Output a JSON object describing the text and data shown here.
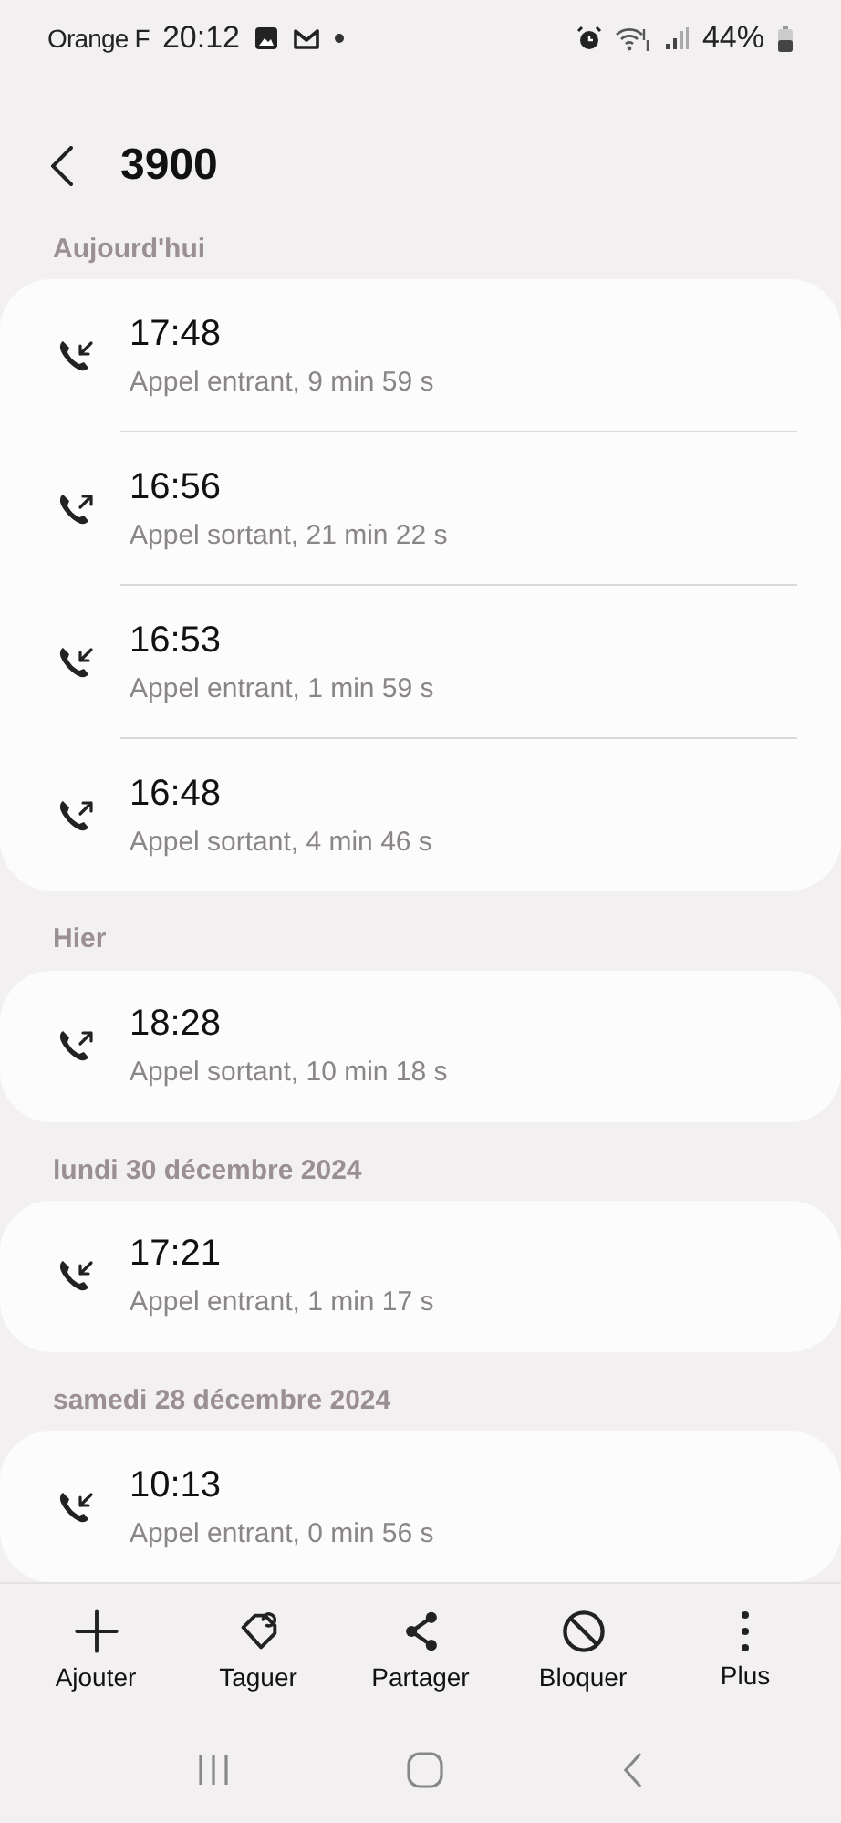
{
  "status_bar": {
    "carrier": "Orange F",
    "time": "20:12",
    "battery": "44%"
  },
  "header": {
    "title": "3900"
  },
  "sections": [
    {
      "label": "Aujourd'hui",
      "calls": [
        {
          "kind": "incoming",
          "time": "17:48",
          "detail": "Appel entrant, 9 min 59 s"
        },
        {
          "kind": "outgoing",
          "time": "16:56",
          "detail": "Appel sortant, 21 min 22 s"
        },
        {
          "kind": "incoming",
          "time": "16:53",
          "detail": "Appel entrant, 1 min 59 s"
        },
        {
          "kind": "outgoing",
          "time": "16:48",
          "detail": "Appel sortant, 4 min 46 s"
        }
      ]
    },
    {
      "label": "Hier",
      "calls": [
        {
          "kind": "outgoing",
          "time": "18:28",
          "detail": "Appel sortant, 10 min 18 s"
        }
      ]
    },
    {
      "label": "lundi 30 décembre 2024",
      "calls": [
        {
          "kind": "incoming",
          "time": "17:21",
          "detail": "Appel entrant, 1 min 17 s"
        }
      ]
    },
    {
      "label": "samedi 28 décembre 2024",
      "calls": [
        {
          "kind": "incoming",
          "time": "10:13",
          "detail": "Appel entrant, 0 min 56 s"
        }
      ]
    }
  ],
  "actions": [
    {
      "kind": "add",
      "label": "Ajouter"
    },
    {
      "kind": "tag",
      "label": "Taguer"
    },
    {
      "kind": "share",
      "label": "Partager"
    },
    {
      "kind": "block",
      "label": "Bloquer"
    },
    {
      "kind": "more",
      "label": "Plus"
    }
  ]
}
